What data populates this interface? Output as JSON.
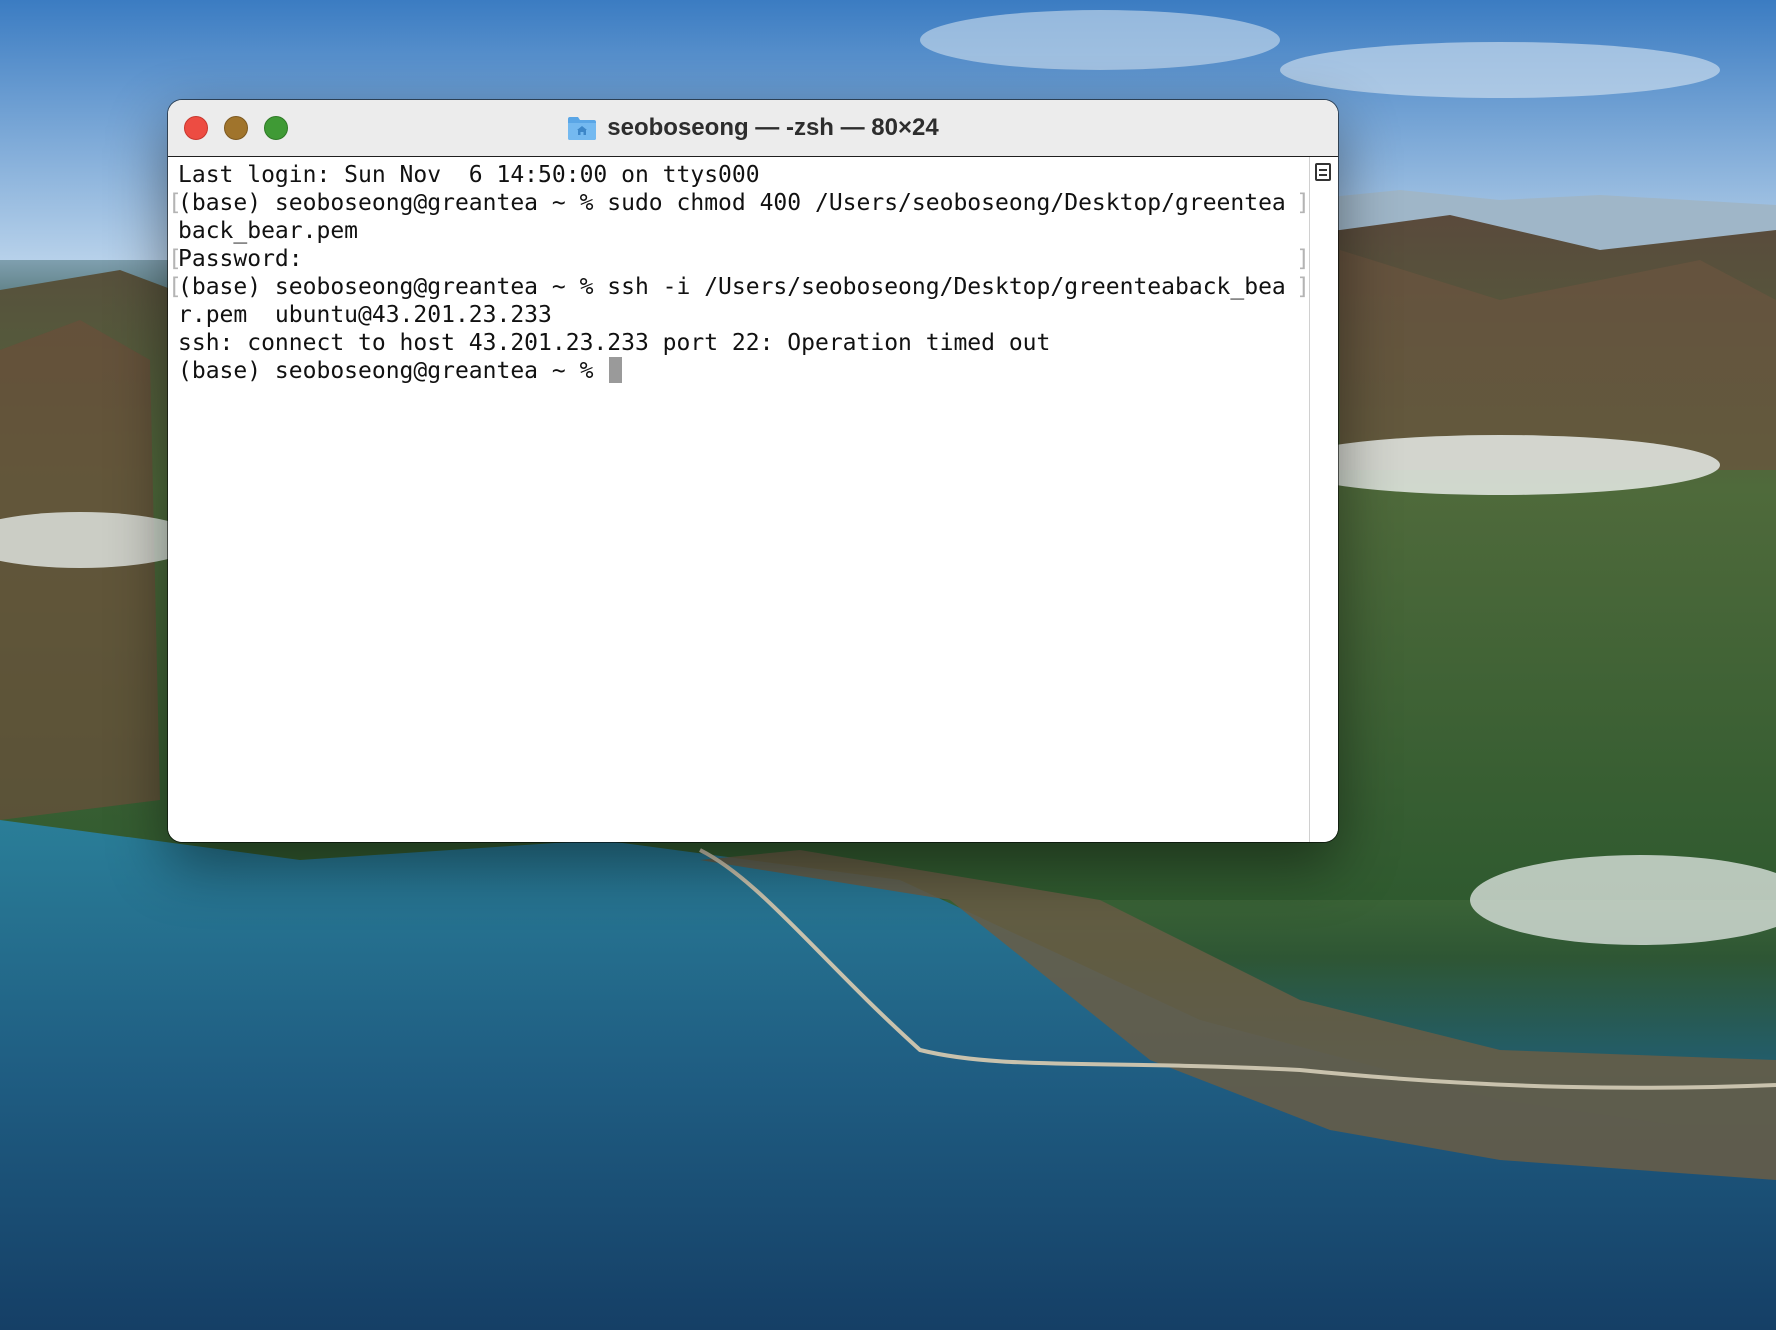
{
  "window": {
    "title": "seoboseong — -zsh — 80×24"
  },
  "terminal": {
    "lines": [
      "Last login: Sun Nov  6 14:50:00 on ttys000",
      "(base) seoboseong@greantea ~ % sudo chmod 400 /Users/seoboseong/Desktop/greentea",
      "back_bear.pem",
      "Password:",
      "(base) seoboseong@greantea ~ % ssh -i /Users/seoboseong/Desktop/greenteaback_bea",
      "r.pem  ubuntu@43.201.23.233",
      "ssh: connect to host 43.201.23.233 port 22: Operation timed out",
      "(base) seoboseong@greantea ~ % "
    ],
    "cursor": "block"
  },
  "icons": {
    "title_icon": "home-folder-icon",
    "scroll_icon": "split-pane-icon"
  },
  "colors": {
    "close": "#ed4c42",
    "minimize": "#a0742c",
    "maximize": "#3f9a35"
  }
}
